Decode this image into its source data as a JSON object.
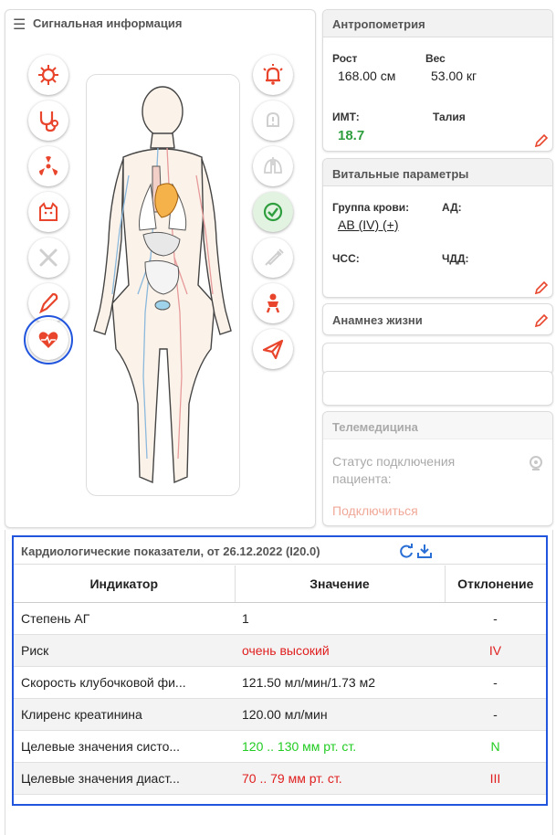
{
  "signal": {
    "title": "Сигнальная информация"
  },
  "anthropometry": {
    "title": "Антропометрия",
    "height_label": "Рост",
    "height_value": "168.00 см",
    "weight_label": "Вес",
    "weight_value": "53.00 кг",
    "bmi_label": "ИМТ:",
    "bmi_value": "18.7",
    "waist_label": "Талия"
  },
  "vitals": {
    "title": "Витальные параметры",
    "blood_group_label": "Группа крови:",
    "blood_group_value": "AB (IV) (+)",
    "bp_label": "АД:",
    "hr_label": "ЧСС:",
    "rr_label": "ЧДД:"
  },
  "anamnesis": {
    "title": "Анамнез жизни"
  },
  "telemedicine": {
    "title": "Телемедицина",
    "status_text": "Статус подключения пациента:",
    "connect_label": "Подключиться"
  },
  "cardio": {
    "title": "Кардиологические показатели, от 26.12.2022 (I20.0)",
    "headers": [
      "Индикатор",
      "Значение",
      "Отклонение"
    ],
    "rows": [
      {
        "indicator": "Степень АГ",
        "value": "1",
        "deviation": "-"
      },
      {
        "indicator": "Риск",
        "value": "очень высокий",
        "deviation": "IV"
      },
      {
        "indicator": "Скорость клубочковой фи...",
        "value": "121.50 мл/мин/1.73 м2",
        "deviation": "-"
      },
      {
        "indicator": "Клиренс креатинина",
        "value": "120.00 мл/мин",
        "deviation": "-"
      },
      {
        "indicator": "Целевые значения систо...",
        "value": "120 .. 130 мм рт. ст.",
        "deviation": "N"
      },
      {
        "indicator": "Целевые значения диаст...",
        "value": "70 .. 79 мм рт. ст.",
        "deviation": "III"
      }
    ]
  },
  "colors": {
    "accent_red": "#e8452c",
    "bmi_green": "#2e9e3e",
    "normal_green": "#22cc22",
    "alert_red": "#e02020",
    "highlight_blue": "#2255dd"
  },
  "icons": {
    "left": [
      "virus-icon",
      "stethoscope-icon",
      "radiation-icon",
      "cat-allergy-icon",
      "bandage-icon",
      "scalpel-icon",
      "heart-pulse-icon"
    ],
    "right": [
      "alarm-icon",
      "warning-bell-icon",
      "lungs-icon",
      "check-badge-icon",
      "syringe-icon",
      "baby-icon",
      "paper-plane-icon"
    ]
  }
}
